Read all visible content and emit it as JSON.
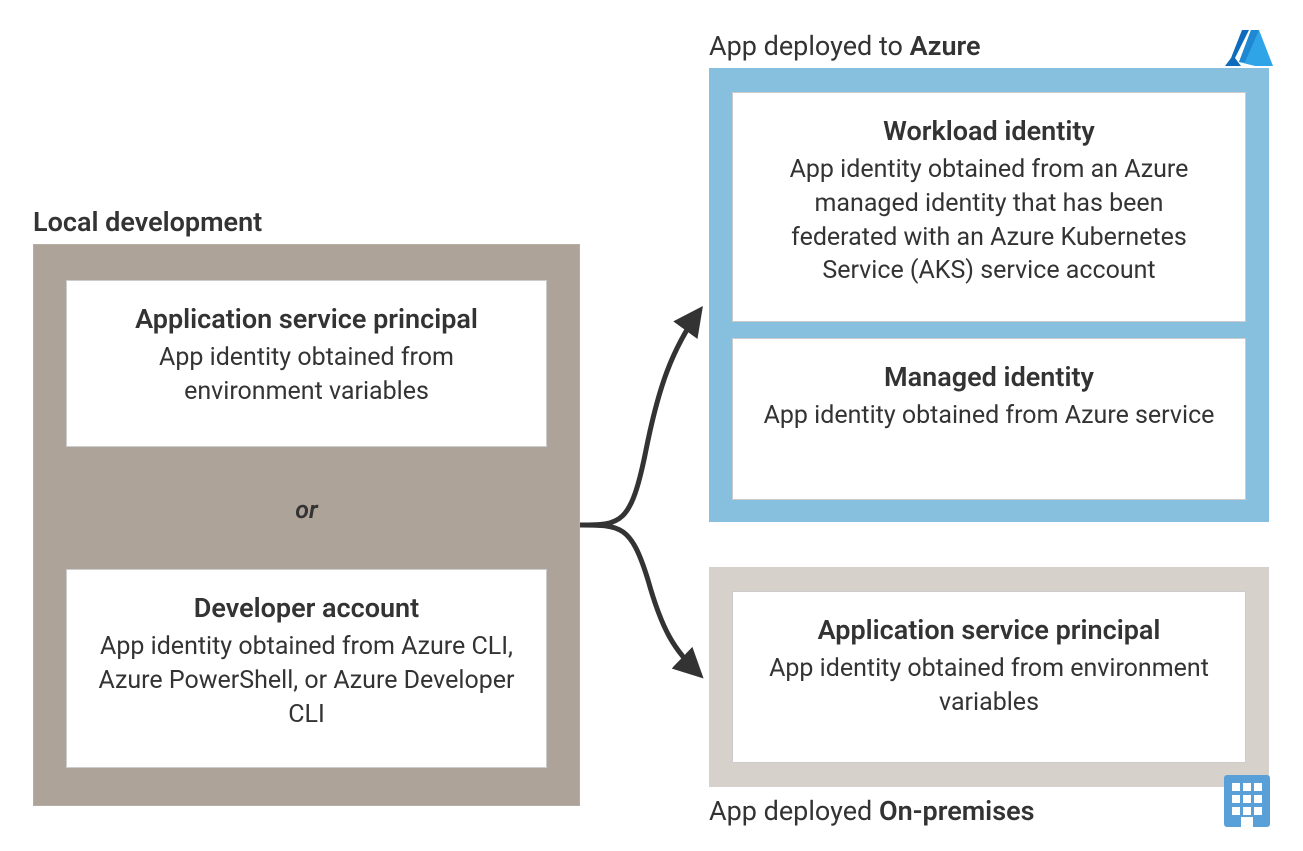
{
  "colors": {
    "local_panel_bg": "#aea399",
    "azure_panel_bg": "#87c0de",
    "onprem_panel_bg": "#d6d2cb",
    "card_bg": "#ffffff",
    "text": "#333333",
    "arrow": "#333333",
    "azure_brand": "#0078d4"
  },
  "local": {
    "label": "Local development",
    "or": "or",
    "cards": {
      "asp": {
        "title": "Application service principal",
        "desc": "App identity obtained from environment variables"
      },
      "dev": {
        "title": "Developer account",
        "desc": "App identity obtained from Azure CLI, Azure PowerShell, or Azure Developer CLI"
      }
    }
  },
  "azure": {
    "label_prefix": "App deployed to ",
    "label_bold": "Azure",
    "icon_name": "azure-logo-icon",
    "cards": {
      "workload": {
        "title": "Workload identity",
        "desc": "App identity obtained from an Azure managed identity that has been federated with an Azure Kubernetes Service (AKS) service account"
      },
      "managed": {
        "title": "Managed identity",
        "desc": "App identity obtained from Azure service"
      }
    }
  },
  "onprem": {
    "label_prefix": "App deployed ",
    "label_bold": "On-premises",
    "icon_name": "building-icon",
    "cards": {
      "asp": {
        "title": "Application service principal",
        "desc": "App identity obtained from environment variables"
      }
    }
  }
}
